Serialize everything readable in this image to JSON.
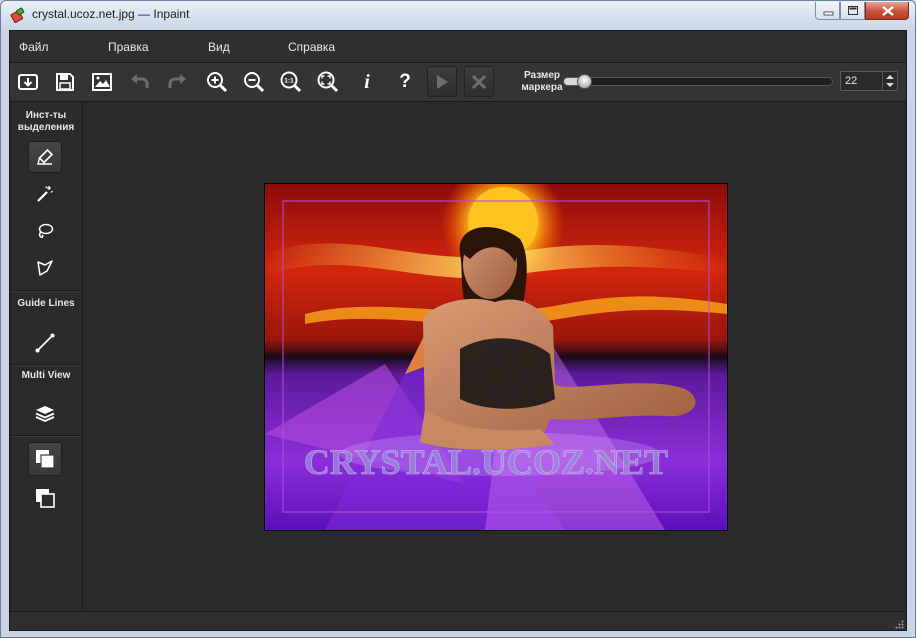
{
  "window": {
    "title": "crystal.ucoz.net.jpg — Inpaint",
    "icon": "inpaint-app-icon"
  },
  "menu": [
    "Файл",
    "Правка",
    "Вид",
    "Справка"
  ],
  "toolbar": {
    "buttons": [
      "open-icon",
      "save-icon",
      "image-icon",
      "undo-icon",
      "redo-icon",
      "zoom-in-icon",
      "zoom-out-icon",
      "actual-size-icon",
      "fit-icon",
      "info-icon",
      "help-icon",
      "run-icon",
      "stop-icon"
    ],
    "actual_size_label": "1:1",
    "info_label": "i",
    "help_label": "?",
    "marker_label": "Размер маркера",
    "marker_size": "22",
    "marker_slider_fraction": 0.05
  },
  "sidebar": {
    "selection_tools_heading": "Инст-ты выделения",
    "guide_lines_heading": "Guide Lines",
    "multi_view_heading": "Multi View",
    "tools": [
      "marker-icon",
      "magic-wand-icon",
      "lasso-icon",
      "polygonal-lasso-icon",
      "guide-line-icon",
      "layers-icon",
      "single-view-icon",
      "duplicate-view-icon"
    ]
  },
  "canvas": {
    "watermark_text": "CRYSTAL.UCOZ.NET"
  },
  "colors": {
    "background": "#2a2a2a",
    "panel": "#343434",
    "selection_border": "#b04fd6"
  }
}
